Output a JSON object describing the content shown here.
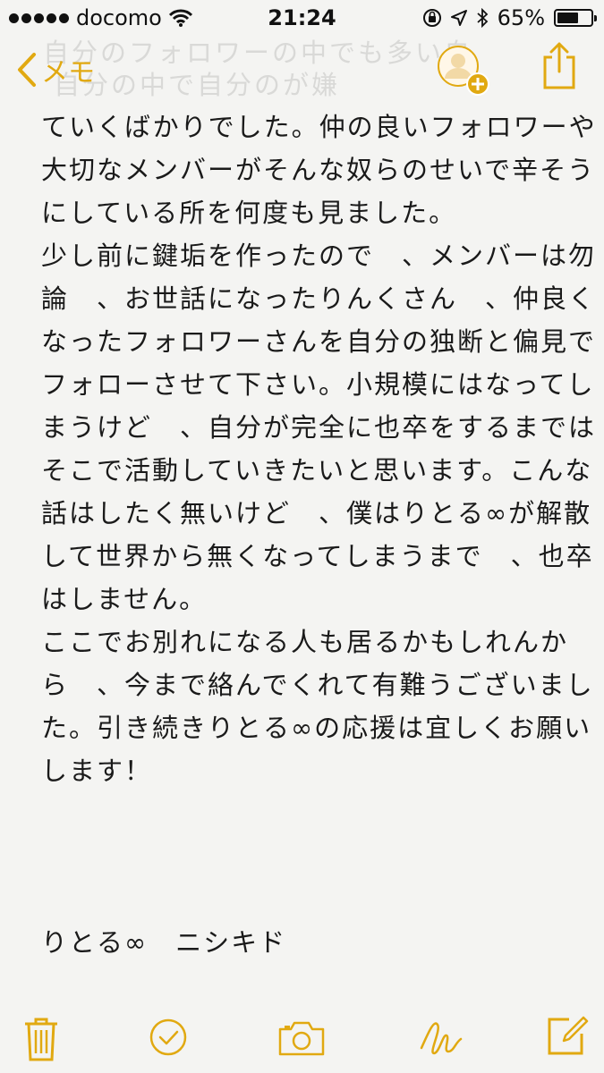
{
  "status_bar": {
    "carrier": "docomo",
    "time": "21:24",
    "battery": "65%",
    "battery_level": 0.65,
    "icons": [
      "signal-dots-icon",
      "wifi-icon",
      "orientation-lock-icon",
      "location-arrow-icon",
      "bluetooth-icon",
      "battery-icon"
    ]
  },
  "nav": {
    "back_label": "メモ",
    "ghost_lines": [
      "自分のフォロワーの中でも多い自",
      "自分の中で自分のが嫌"
    ],
    "icons": [
      "chevron-left-icon",
      "add-person-icon",
      "share-icon"
    ]
  },
  "note": {
    "lines": [
      "ていくばかりでした。仲の良いフォロワーや",
      "大切なメンバーがそんな奴らのせいで辛そう",
      "にしている所を何度も見ました。",
      "少し前に鍵垢を作ったので　、メンバーは勿",
      "論　、お世話になったりんくさん　、仲良く",
      "なったフォロワーさんを自分の独断と偏見で",
      "フォローさせて下さい。小規模にはなってし",
      "まうけど　、自分が完全に也卒をするまでは",
      "そこで活動していきたいと思います。こんな",
      "話はしたく無いけど　、僕はりとる∞が解散",
      "して世界から無くなってしまうまで　、也卒",
      "はしません。",
      "ここでお別れになる人も居るかもしれんか",
      "ら　、今まで絡んでくれて有難うございまし",
      "た。引き続きりとる∞の応援は宜しくお願い",
      "します！"
    ],
    "signature": "りとる∞　ニシキド"
  },
  "toolbar": {
    "accent": "#e1a911",
    "icons": [
      "trash-icon",
      "checklist-icon",
      "camera-icon",
      "sketch-icon",
      "compose-icon"
    ]
  }
}
